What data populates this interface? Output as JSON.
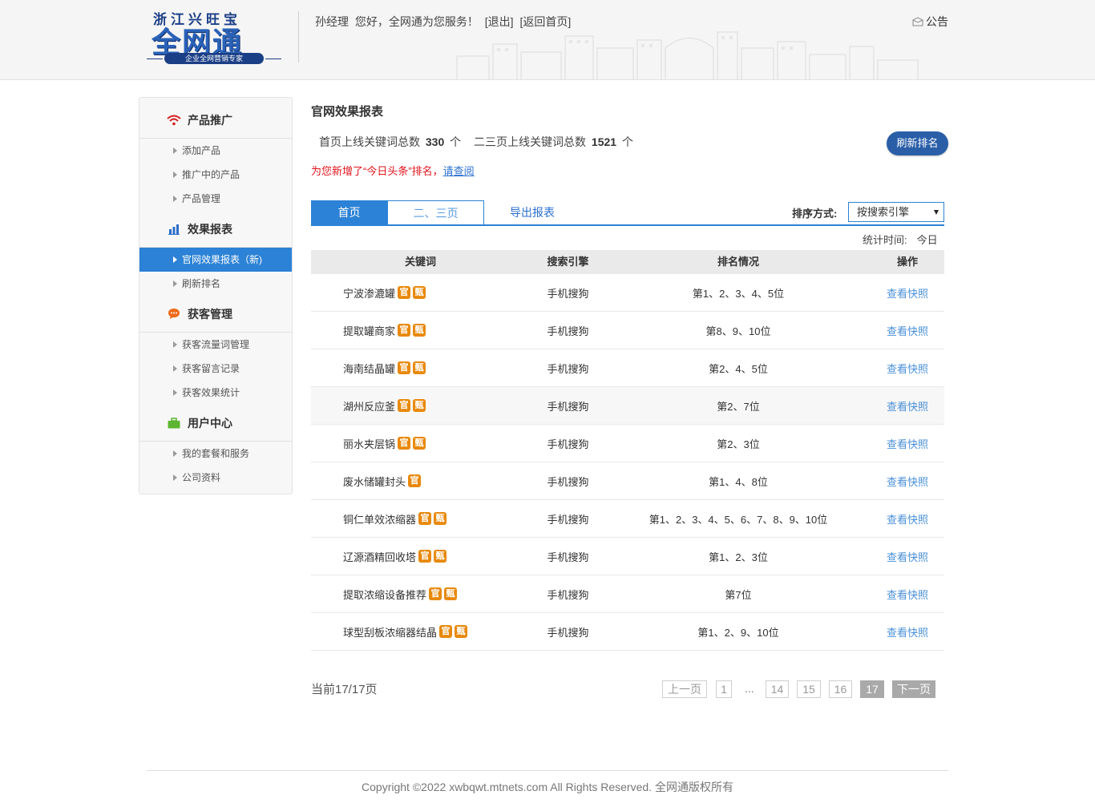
{
  "header": {
    "logo_top": "浙江兴旺宝",
    "logo_main": "全网通",
    "logo_sub": "企业全网营销专家",
    "user": "孙经理",
    "welcome": "您好，全网通为您服务！",
    "logout": "[退出]",
    "home": "[返回首页]",
    "notice": "公告"
  },
  "sidebar": {
    "sections": [
      {
        "title": "产品推广",
        "items": [
          "添加产品",
          "推广中的产品",
          "产品管理"
        ]
      },
      {
        "title": "效果报表",
        "items": [
          "官网效果报表（新)",
          "刷新排名"
        ]
      },
      {
        "title": "获客管理",
        "items": [
          "获客流量词管理",
          "获客留言记录",
          "获客效果统计"
        ]
      },
      {
        "title": "用户中心",
        "items": [
          "我的套餐和服务",
          "公司资料"
        ]
      }
    ]
  },
  "main": {
    "title": "官网效果报表",
    "stats": {
      "first_label": "首页上线关键词总数",
      "first_value": "330",
      "first_unit": "个",
      "second_label": "二三页上线关键词总数",
      "second_value": "1521",
      "second_unit": "个"
    },
    "refresh_label": "刷新排名",
    "notice_text": "为您新增了“今日头条”排名，",
    "notice_link": "请查阅",
    "tabs": [
      "首页",
      "二、三页",
      "导出报表"
    ],
    "sort_label": "排序方式:",
    "sort_value": "按搜索引擎",
    "stat_time_label": "统计时间:",
    "stat_time_value": "今日",
    "table": {
      "headers": [
        "关键词",
        "搜索引擎",
        "排名情况",
        "操作"
      ],
      "rows": [
        {
          "keyword": "宁波渗漉罐",
          "badges": [
            "官",
            "甄"
          ],
          "engine": "手机搜狗",
          "rank": "第1、2、3、4、5位",
          "action": "查看快照"
        },
        {
          "keyword": "提取罐商家",
          "badges": [
            "官",
            "甄"
          ],
          "engine": "手机搜狗",
          "rank": "第8、9、10位",
          "action": "查看快照"
        },
        {
          "keyword": "海南结晶罐",
          "badges": [
            "官",
            "甄"
          ],
          "engine": "手机搜狗",
          "rank": "第2、4、5位",
          "action": "查看快照"
        },
        {
          "keyword": "湖州反应釜",
          "badges": [
            "官",
            "甄"
          ],
          "engine": "手机搜狗",
          "rank": "第2、7位",
          "action": "查看快照"
        },
        {
          "keyword": "丽水夹层锅",
          "badges": [
            "官",
            "甄"
          ],
          "engine": "手机搜狗",
          "rank": "第2、3位",
          "action": "查看快照"
        },
        {
          "keyword": "废水储罐封头",
          "badges": [
            "官"
          ],
          "engine": "手机搜狗",
          "rank": "第1、4、8位",
          "action": "查看快照"
        },
        {
          "keyword": "铜仁单效浓缩器",
          "badges": [
            "官",
            "甄"
          ],
          "engine": "手机搜狗",
          "rank": "第1、2、3、4、5、6、7、8、9、10位",
          "action": "查看快照"
        },
        {
          "keyword": "辽源酒精回收塔",
          "badges": [
            "官",
            "甄"
          ],
          "engine": "手机搜狗",
          "rank": "第1、2、3位",
          "action": "查看快照"
        },
        {
          "keyword": "提取浓缩设备推荐",
          "badges": [
            "官",
            "甄"
          ],
          "engine": "手机搜狗",
          "rank": "第7位",
          "action": "查看快照"
        },
        {
          "keyword": "球型刮板浓缩器结晶",
          "badges": [
            "官",
            "甄"
          ],
          "engine": "手机搜狗",
          "rank": "第1、2、9、10位",
          "action": "查看快照"
        }
      ]
    },
    "page_info": "当前17/17页",
    "pager": {
      "prev": "上一页",
      "pages": [
        "1",
        "...",
        "14",
        "15",
        "16",
        "17"
      ],
      "current": "17",
      "next": "下一页"
    }
  },
  "footer": {
    "copyright": "Copyright ©2022 xwbqwt.mtnets.com All Rights Reserved. 全网通版权所有"
  },
  "colors": {
    "accent": "#2c82d6",
    "refresh_button": "#2a5fa8",
    "badge": "#e8890c",
    "notice_red": "#e0141c",
    "link_blue": "#4a90d9"
  }
}
